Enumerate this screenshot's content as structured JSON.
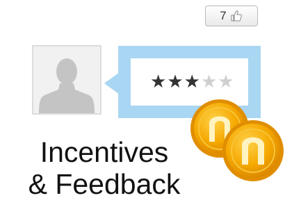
{
  "like_button": {
    "count": "7",
    "icon": "thumbs-up-icon"
  },
  "profile": {
    "avatar_icon": "person-silhouette-icon"
  },
  "rating": {
    "value": 3,
    "max": 5
  },
  "coins": {
    "count": 2,
    "color": "#f5a800"
  },
  "caption": {
    "line1": "Incentives",
    "line2": "& Feedback"
  },
  "colors": {
    "bubble": "#a9d6f2",
    "star_filled": "#333333",
    "star_empty": "#cfcfcf"
  }
}
